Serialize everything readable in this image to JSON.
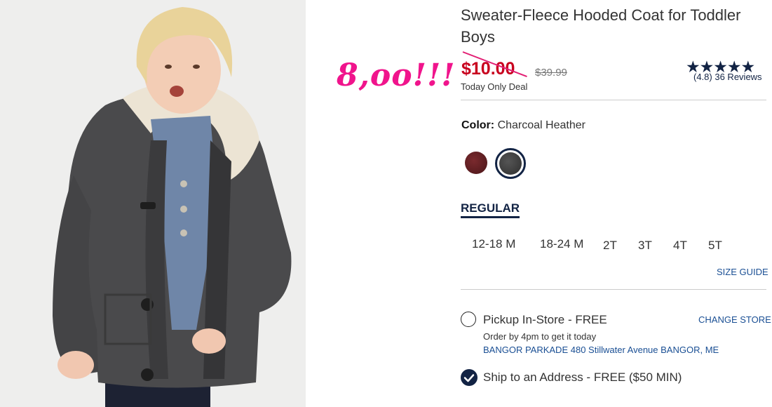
{
  "annotation": "8,oo!!!",
  "product": {
    "title": "Sweater-Fleece Hooded Coat for Toddler Boys",
    "sale_price": "$10.00",
    "original_price": "$39.99",
    "deal_label": "Today Only Deal",
    "rating_stars": "★★★★★",
    "rating": "(4.8)",
    "reviews": "36 Reviews"
  },
  "color": {
    "label": "Color:",
    "value": "Charcoal Heather",
    "swatches": [
      {
        "name": "burgundy",
        "color": "#5c1c20"
      },
      {
        "name": "charcoal",
        "color": "#3a3a3a",
        "selected": true
      }
    ]
  },
  "size": {
    "tab": "REGULAR",
    "options": [
      "12-18 M",
      "18-24 M",
      "2T",
      "3T",
      "4T",
      "5T"
    ],
    "guide": "SIZE GUIDE"
  },
  "fulfillment": {
    "pickup_label": "Pickup In-Store - FREE",
    "change_store": "CHANGE STORE",
    "order_note": "Order by 4pm to get it today",
    "store_address": "BANGOR PARKADE 480 Stillwater Avenue  BANGOR, ME",
    "ship_label": "Ship to an Address - FREE ($50 MIN)"
  },
  "colors": {
    "accent": "#122344",
    "sale": "#c8001e",
    "link": "#1a4f94",
    "annotation": "#f0148c"
  }
}
